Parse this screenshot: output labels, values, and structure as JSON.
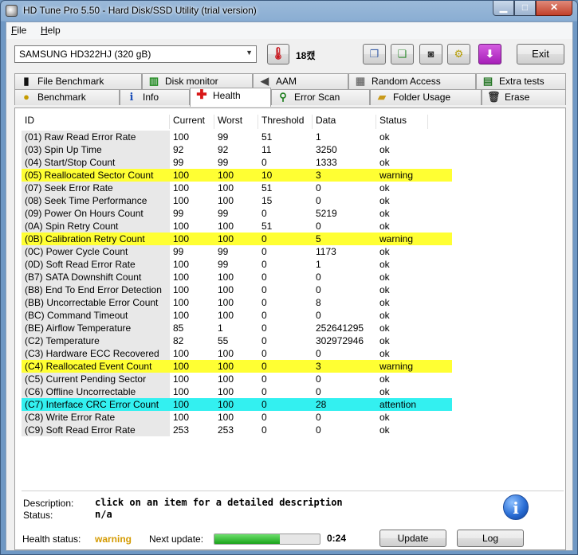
{
  "window": {
    "title": "HD Tune Pro 5.50 - Hard Disk/SSD Utility (trial version)"
  },
  "menu": [
    {
      "key": "F",
      "rest": "ile"
    },
    {
      "key": "H",
      "rest": "elp"
    }
  ],
  "toolbar": {
    "drive": "SAMSUNG HD322HJ (320 gB)",
    "temperature": "18캤",
    "exit_label": "Exit"
  },
  "tabs_top": [
    {
      "label": "File Benchmark",
      "icon": "file-benchmark-icon"
    },
    {
      "label": "Disk monitor",
      "icon": "disk-monitor-icon"
    },
    {
      "label": "AAM",
      "icon": "speaker-icon"
    },
    {
      "label": "Random Access",
      "icon": "random-access-icon"
    },
    {
      "label": "Extra tests",
      "icon": "extra-tests-icon"
    }
  ],
  "tabs_bottom": [
    {
      "label": "Benchmark",
      "icon": "lightbulb-icon"
    },
    {
      "label": "Info",
      "icon": "info-icon"
    },
    {
      "label": "Health",
      "icon": "red-cross-icon"
    },
    {
      "label": "Error Scan",
      "icon": "magnifier-icon"
    },
    {
      "label": "Folder Usage",
      "icon": "folder-icon"
    },
    {
      "label": "Erase",
      "icon": "trash-icon"
    }
  ],
  "table": {
    "headers": [
      "ID",
      "Current",
      "Worst",
      "Threshold",
      "Data",
      "Status"
    ],
    "rows": [
      {
        "id": "(01) Raw Read Error Rate",
        "current": "100",
        "worst": "99",
        "threshold": "51",
        "data": "1",
        "status": "ok",
        "level": "ok"
      },
      {
        "id": "(03) Spin Up Time",
        "current": "92",
        "worst": "92",
        "threshold": "11",
        "data": "3250",
        "status": "ok",
        "level": "ok"
      },
      {
        "id": "(04) Start/Stop Count",
        "current": "99",
        "worst": "99",
        "threshold": "0",
        "data": "1333",
        "status": "ok",
        "level": "ok"
      },
      {
        "id": "(05) Reallocated Sector Count",
        "current": "100",
        "worst": "100",
        "threshold": "10",
        "data": "3",
        "status": "warning",
        "level": "warn"
      },
      {
        "id": "(07) Seek Error Rate",
        "current": "100",
        "worst": "100",
        "threshold": "51",
        "data": "0",
        "status": "ok",
        "level": "ok"
      },
      {
        "id": "(08) Seek Time Performance",
        "current": "100",
        "worst": "100",
        "threshold": "15",
        "data": "0",
        "status": "ok",
        "level": "ok"
      },
      {
        "id": "(09) Power On Hours Count",
        "current": "99",
        "worst": "99",
        "threshold": "0",
        "data": "5219",
        "status": "ok",
        "level": "ok"
      },
      {
        "id": "(0A) Spin Retry Count",
        "current": "100",
        "worst": "100",
        "threshold": "51",
        "data": "0",
        "status": "ok",
        "level": "ok"
      },
      {
        "id": "(0B) Calibration Retry Count",
        "current": "100",
        "worst": "100",
        "threshold": "0",
        "data": "5",
        "status": "warning",
        "level": "warn"
      },
      {
        "id": "(0C) Power Cycle Count",
        "current": "99",
        "worst": "99",
        "threshold": "0",
        "data": "1173",
        "status": "ok",
        "level": "ok"
      },
      {
        "id": "(0D) Soft Read Error Rate",
        "current": "100",
        "worst": "99",
        "threshold": "0",
        "data": "1",
        "status": "ok",
        "level": "ok"
      },
      {
        "id": "(B7) SATA Downshift Count",
        "current": "100",
        "worst": "100",
        "threshold": "0",
        "data": "0",
        "status": "ok",
        "level": "ok"
      },
      {
        "id": "(B8) End To End Error Detection",
        "current": "100",
        "worst": "100",
        "threshold": "0",
        "data": "0",
        "status": "ok",
        "level": "ok"
      },
      {
        "id": "(BB) Uncorrectable Error Count",
        "current": "100",
        "worst": "100",
        "threshold": "0",
        "data": "8",
        "status": "ok",
        "level": "ok"
      },
      {
        "id": "(BC) Command Timeout",
        "current": "100",
        "worst": "100",
        "threshold": "0",
        "data": "0",
        "status": "ok",
        "level": "ok"
      },
      {
        "id": "(BE) Airflow Temperature",
        "current": "85",
        "worst": "1",
        "threshold": "0",
        "data": "252641295",
        "status": "ok",
        "level": "ok"
      },
      {
        "id": "(C2) Temperature",
        "current": "82",
        "worst": "55",
        "threshold": "0",
        "data": "302972946",
        "status": "ok",
        "level": "ok"
      },
      {
        "id": "(C3) Hardware ECC Recovered",
        "current": "100",
        "worst": "100",
        "threshold": "0",
        "data": "0",
        "status": "ok",
        "level": "ok"
      },
      {
        "id": "(C4) Reallocated Event Count",
        "current": "100",
        "worst": "100",
        "threshold": "0",
        "data": "3",
        "status": "warning",
        "level": "warn"
      },
      {
        "id": "(C5) Current Pending Sector",
        "current": "100",
        "worst": "100",
        "threshold": "0",
        "data": "0",
        "status": "ok",
        "level": "ok"
      },
      {
        "id": "(C6) Offline Uncorrectable",
        "current": "100",
        "worst": "100",
        "threshold": "0",
        "data": "0",
        "status": "ok",
        "level": "ok"
      },
      {
        "id": "(C7) Interface CRC Error Count",
        "current": "100",
        "worst": "100",
        "threshold": "0",
        "data": "28",
        "status": "attention",
        "level": "attn"
      },
      {
        "id": "(C8) Write Error Rate",
        "current": "100",
        "worst": "100",
        "threshold": "0",
        "data": "0",
        "status": "ok",
        "level": "ok"
      },
      {
        "id": "(C9) Soft Read Error Rate",
        "current": "253",
        "worst": "253",
        "threshold": "0",
        "data": "0",
        "status": "ok",
        "level": "ok"
      }
    ]
  },
  "details": {
    "description_label": "Description:",
    "description_value": "click on an item for a detailed description",
    "status_label": "Status:",
    "status_value": "n/a"
  },
  "statusbar": {
    "health_label": "Health status:",
    "health_value": "warning",
    "next_update_label": "Next update:",
    "progress_fraction": 0.62,
    "time": "0:24",
    "update_label": "Update",
    "log_label": "Log"
  }
}
